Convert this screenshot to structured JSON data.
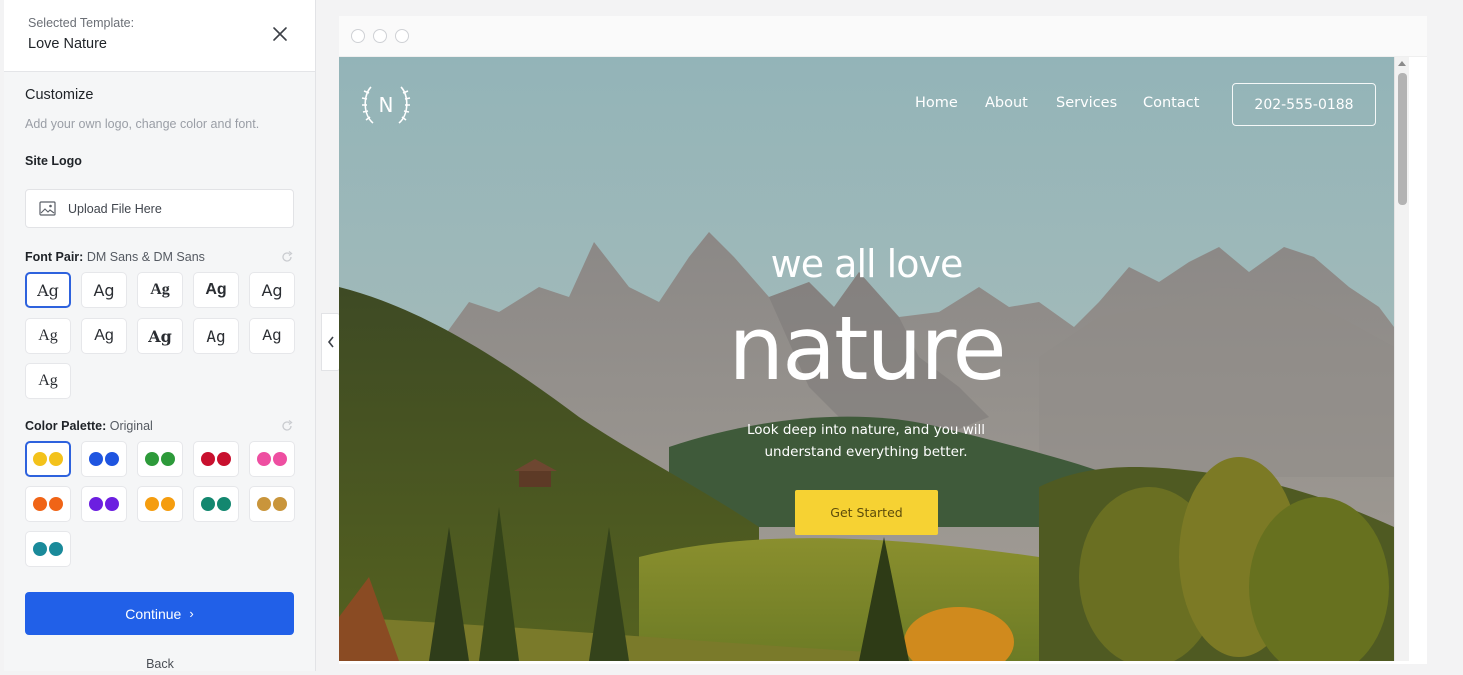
{
  "sidebar": {
    "header_label": "Selected Template:",
    "template_name": "Love Nature",
    "customize_title": "Customize",
    "customize_subtitle": "Add your own logo, change color and font.",
    "site_logo_label": "Site Logo",
    "upload_label": "Upload File Here",
    "font_pair_label": "Font Pair:",
    "font_pair_value": "DM Sans & DM Sans",
    "font_sample": "Ag",
    "color_palette_label": "Color Palette:",
    "color_palette_value": "Original",
    "palettes": [
      [
        "#f3c21b",
        "#f3c21b"
      ],
      [
        "#1f55e0",
        "#1f55e0"
      ],
      [
        "#2d9a3a",
        "#2d9a3a"
      ],
      [
        "#c8102e",
        "#c8102e"
      ],
      [
        "#ee4fa1",
        "#ee4fa1"
      ],
      [
        "#f06416",
        "#f06416"
      ],
      [
        "#6c1fe0",
        "#6c1fe0"
      ],
      [
        "#f59d0f",
        "#f59d0f"
      ],
      [
        "#13876f",
        "#13876f"
      ],
      [
        "#c9953b",
        "#c9953b"
      ],
      [
        "#1a8a9a",
        "#1a8a9a"
      ]
    ],
    "continue_label": "Continue",
    "continue_chevron": "›",
    "back_label": "Back"
  },
  "preview": {
    "logo_letter": "N",
    "nav": [
      "Home",
      "About",
      "Services",
      "Contact"
    ],
    "phone": "202-555-0188",
    "headline_small": "we all love",
    "headline_big": "nature",
    "description": "Look deep into nature, and you will understand everything better.",
    "cta_label": "Get Started"
  },
  "colors": {
    "accent": "#2160e8",
    "cta": "#f6d233"
  }
}
